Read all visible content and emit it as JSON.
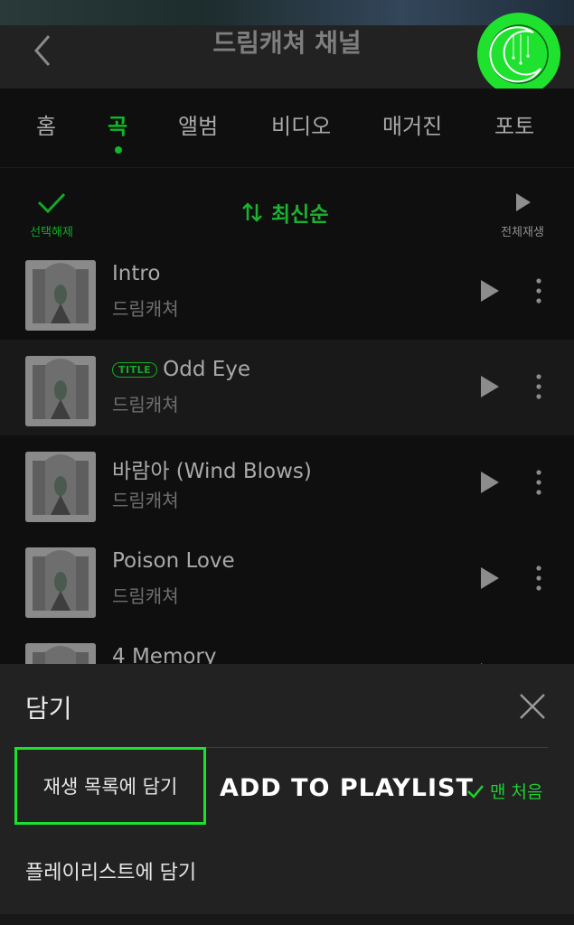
{
  "header": {
    "title": "드림캐쳐 채널",
    "back_icon": "chevron-left-icon",
    "avatar_icon": "dreamcatcher-logo-icon"
  },
  "tabs": [
    {
      "label": "홈",
      "active": false
    },
    {
      "label": "곡",
      "active": true
    },
    {
      "label": "앨범",
      "active": false
    },
    {
      "label": "비디오",
      "active": false
    },
    {
      "label": "매거진",
      "active": false
    },
    {
      "label": "포토",
      "active": false
    }
  ],
  "toolbar": {
    "deselect_label": "선택해제",
    "sort_label": "최신순",
    "play_all_label": "전체재생"
  },
  "songs": [
    {
      "title": "Intro",
      "artist": "드림캐쳐",
      "badge": ""
    },
    {
      "title": "Odd Eye",
      "artist": "드림캐쳐",
      "badge": "TITLE"
    },
    {
      "title": "바람아 (Wind Blows)",
      "artist": "드림캐쳐",
      "badge": ""
    },
    {
      "title": "Poison Love",
      "artist": "드림캐쳐",
      "badge": ""
    },
    {
      "title": "4 Memory",
      "artist": "",
      "badge": ""
    }
  ],
  "sheet": {
    "title": "담기",
    "add_to_queue_label": "재생 목록에 담기",
    "add_to_playlist_caption": "ADD TO PLAYLIST",
    "to_top_label": "맨 처음",
    "add_to_my_playlist_label": "플레이리스트에 담기"
  },
  "colors": {
    "accent": "#10b827",
    "highlight_border": "#1be02c",
    "background": "#0f0f0f",
    "sheet_bg": "#222222"
  }
}
